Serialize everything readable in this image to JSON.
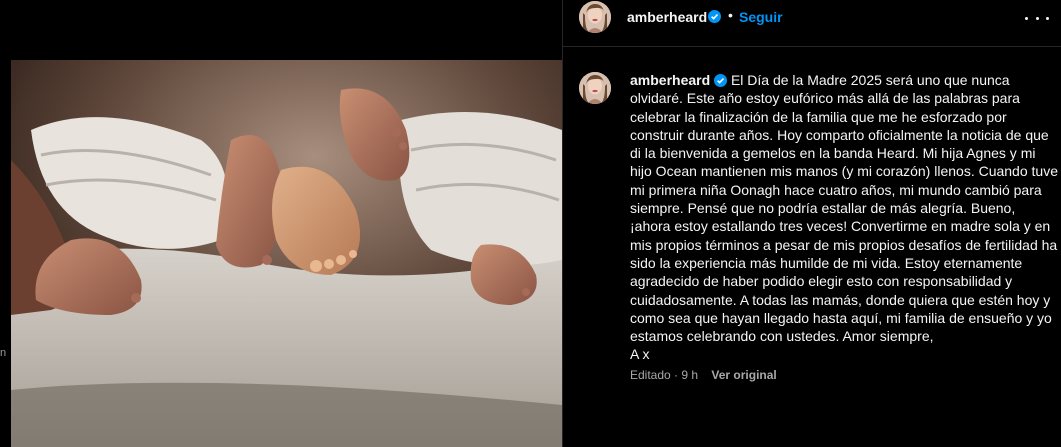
{
  "post": {
    "username": "amberheard",
    "follow_label": "Seguir",
    "header_dot": "•",
    "caption_body": "El Día de la Madre 2025 será uno que nunca olvidaré. Este año estoy eufórico más allá de las palabras para celebrar la finalización de la familia que me he esforzado por construir durante años. Hoy comparto oficialmente la noticia de que di la bienvenida a gemelos en la banda Heard. Mi hija Agnes y mi hijo Ocean mantienen mis manos (y mi corazón) llenos. Cuando tuve mi primera niña Oonagh hace cuatro años, mi mundo cambió para siempre. Pensé que no podría estallar de más alegría. Bueno, ¡ahora estoy estallando tres veces! Convertirme en madre sola y en mis propios términos a pesar de mis propios desafíos de fertilidad ha sido la experiencia más humilde de mi vida. Estoy eternamente agradecido de haber podido elegir esto con responsabilidad y cuidadosamente. A todas las mamás, donde quiera que estén hoy y como sea que hayan llegado hasta aquí, mi familia de ensueño y yo estamos celebrando con ustedes. Amor siempre,",
    "caption_signoff": "A x",
    "meta_time": "Editado · 9 h",
    "translate_label": "Ver original",
    "edge_glyph": "n"
  },
  "colors": {
    "accent": "#0095f6",
    "verified": "#0095f6",
    "secondary_text": "#a8a8a8",
    "divider": "#262626"
  },
  "icons": {
    "verified": "verified-badge-icon",
    "more": "more-options-icon"
  }
}
